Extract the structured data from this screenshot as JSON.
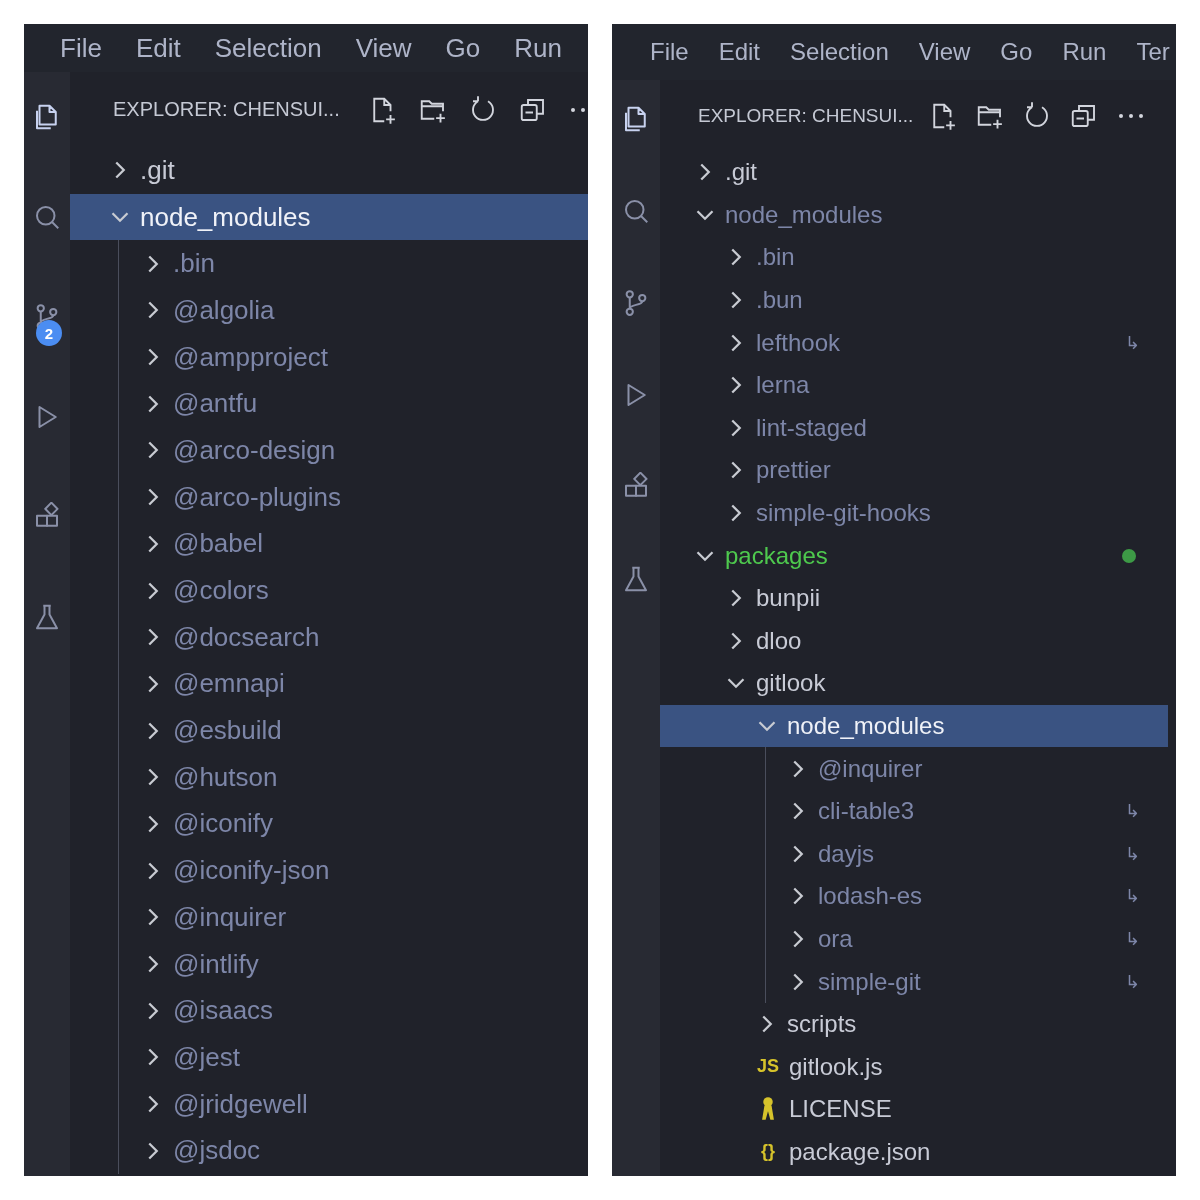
{
  "panels": [
    {
      "menu": [
        "File",
        "Edit",
        "Selection",
        "View",
        "Go",
        "Run"
      ],
      "activity_badge": "2",
      "explorer_title": "EXPLORER: CHENSUI...",
      "tree": [
        {
          "name": ".git",
          "kind": "folder",
          "expanded": false,
          "selected": false,
          "ignored": false
        },
        {
          "name": "node_modules",
          "kind": "folder",
          "expanded": true,
          "selected": true,
          "ignored": true,
          "children": [
            {
              "name": ".bin",
              "kind": "folder",
              "expanded": false,
              "selected": false,
              "ignored": true
            },
            {
              "name": "@algolia",
              "kind": "folder",
              "expanded": false,
              "selected": false,
              "ignored": true
            },
            {
              "name": "@ampproject",
              "kind": "folder",
              "expanded": false,
              "selected": false,
              "ignored": true
            },
            {
              "name": "@antfu",
              "kind": "folder",
              "expanded": false,
              "selected": false,
              "ignored": true
            },
            {
              "name": "@arco-design",
              "kind": "folder",
              "expanded": false,
              "selected": false,
              "ignored": true
            },
            {
              "name": "@arco-plugins",
              "kind": "folder",
              "expanded": false,
              "selected": false,
              "ignored": true
            },
            {
              "name": "@babel",
              "kind": "folder",
              "expanded": false,
              "selected": false,
              "ignored": true
            },
            {
              "name": "@colors",
              "kind": "folder",
              "expanded": false,
              "selected": false,
              "ignored": true
            },
            {
              "name": "@docsearch",
              "kind": "folder",
              "expanded": false,
              "selected": false,
              "ignored": true
            },
            {
              "name": "@emnapi",
              "kind": "folder",
              "expanded": false,
              "selected": false,
              "ignored": true
            },
            {
              "name": "@esbuild",
              "kind": "folder",
              "expanded": false,
              "selected": false,
              "ignored": true
            },
            {
              "name": "@hutson",
              "kind": "folder",
              "expanded": false,
              "selected": false,
              "ignored": true
            },
            {
              "name": "@iconify",
              "kind": "folder",
              "expanded": false,
              "selected": false,
              "ignored": true
            },
            {
              "name": "@iconify-json",
              "kind": "folder",
              "expanded": false,
              "selected": false,
              "ignored": true
            },
            {
              "name": "@inquirer",
              "kind": "folder",
              "expanded": false,
              "selected": false,
              "ignored": true
            },
            {
              "name": "@intlify",
              "kind": "folder",
              "expanded": false,
              "selected": false,
              "ignored": true
            },
            {
              "name": "@isaacs",
              "kind": "folder",
              "expanded": false,
              "selected": false,
              "ignored": true
            },
            {
              "name": "@jest",
              "kind": "folder",
              "expanded": false,
              "selected": false,
              "ignored": true
            },
            {
              "name": "@jridgewell",
              "kind": "folder",
              "expanded": false,
              "selected": false,
              "ignored": true
            },
            {
              "name": "@jsdoc",
              "kind": "folder",
              "expanded": false,
              "selected": false,
              "ignored": true
            }
          ]
        }
      ]
    },
    {
      "menu": [
        "File",
        "Edit",
        "Selection",
        "View",
        "Go",
        "Run",
        "Ter"
      ],
      "explorer_title": "EXPLORER: CHENSUI...",
      "tree": [
        {
          "name": ".git",
          "kind": "folder",
          "expanded": false,
          "selected": false,
          "ignored": false
        },
        {
          "name": "node_modules",
          "kind": "folder",
          "expanded": true,
          "selected": false,
          "ignored": true,
          "children": [
            {
              "name": ".bin",
              "kind": "folder",
              "expanded": false,
              "selected": false,
              "ignored": true
            },
            {
              "name": ".bun",
              "kind": "folder",
              "expanded": false,
              "selected": false,
              "ignored": true
            },
            {
              "name": "lefthook",
              "kind": "folder",
              "expanded": false,
              "selected": false,
              "ignored": true,
              "symlink": "↳"
            },
            {
              "name": "lerna",
              "kind": "folder",
              "expanded": false,
              "selected": false,
              "ignored": true
            },
            {
              "name": "lint-staged",
              "kind": "folder",
              "expanded": false,
              "selected": false,
              "ignored": true
            },
            {
              "name": "prettier",
              "kind": "folder",
              "expanded": false,
              "selected": false,
              "ignored": true
            },
            {
              "name": "simple-git-hooks",
              "kind": "folder",
              "expanded": false,
              "selected": false,
              "ignored": true
            }
          ]
        },
        {
          "name": "packages",
          "kind": "folder",
          "expanded": true,
          "selected": false,
          "ignored": false,
          "added": true,
          "children": [
            {
              "name": "bunpii",
              "kind": "folder",
              "expanded": false,
              "selected": false,
              "ignored": false
            },
            {
              "name": "dloo",
              "kind": "folder",
              "expanded": false,
              "selected": false,
              "ignored": false
            },
            {
              "name": "gitlook",
              "kind": "folder",
              "expanded": true,
              "selected": false,
              "ignored": false,
              "children": [
                {
                  "name": "node_modules",
                  "kind": "folder",
                  "expanded": true,
                  "selected": true,
                  "ignored": true,
                  "children": [
                    {
                      "name": "@inquirer",
                      "kind": "folder",
                      "expanded": false,
                      "selected": false,
                      "ignored": true
                    },
                    {
                      "name": "cli-table3",
                      "kind": "folder",
                      "expanded": false,
                      "selected": false,
                      "ignored": true,
                      "symlink": "↳"
                    },
                    {
                      "name": "dayjs",
                      "kind": "folder",
                      "expanded": false,
                      "selected": false,
                      "ignored": true,
                      "symlink": "↳"
                    },
                    {
                      "name": "lodash-es",
                      "kind": "folder",
                      "expanded": false,
                      "selected": false,
                      "ignored": true,
                      "symlink": "↳"
                    },
                    {
                      "name": "ora",
                      "kind": "folder",
                      "expanded": false,
                      "selected": false,
                      "ignored": true,
                      "symlink": "↳"
                    },
                    {
                      "name": "simple-git",
                      "kind": "folder",
                      "expanded": false,
                      "selected": false,
                      "ignored": true,
                      "symlink": "↳"
                    }
                  ]
                },
                {
                  "name": "scripts",
                  "kind": "folder",
                  "expanded": false,
                  "selected": false,
                  "ignored": false
                },
                {
                  "name": "gitlook.js",
                  "kind": "js",
                  "icon_text": "JS",
                  "selected": false,
                  "ignored": false
                },
                {
                  "name": "LICENSE",
                  "kind": "license",
                  "selected": false,
                  "ignored": false
                },
                {
                  "name": "package.json",
                  "kind": "json",
                  "icon_text": "{}",
                  "selected": false,
                  "ignored": false
                }
              ]
            }
          ]
        }
      ]
    }
  ]
}
